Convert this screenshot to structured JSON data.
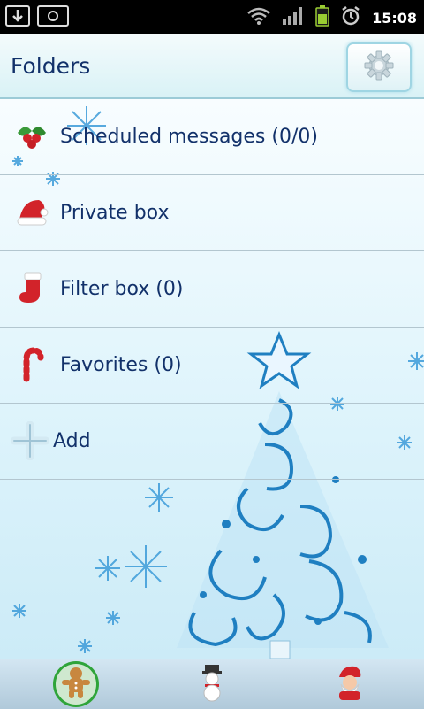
{
  "status_bar": {
    "time": "15:08",
    "icons": [
      "download-icon",
      "screenshot-icon",
      "wifi-icon",
      "signal-icon",
      "battery-icon",
      "alarm-icon"
    ]
  },
  "header": {
    "title": "Folders",
    "settings_icon": "gear-icon"
  },
  "folders": [
    {
      "label": "Scheduled messages (0/0)",
      "icon": "holly-icon"
    },
    {
      "label": "Private box",
      "icon": "santa-hat-icon"
    },
    {
      "label": "Filter box (0)",
      "icon": "stocking-icon"
    },
    {
      "label": "Favorites (0)",
      "icon": "candy-cane-icon"
    },
    {
      "label": "Add",
      "icon": "plus-icon"
    }
  ],
  "bottom_tabs": [
    {
      "icon": "gingerbread-icon",
      "active": true
    },
    {
      "icon": "snowman-icon",
      "active": false
    },
    {
      "icon": "santa-icon",
      "active": false
    }
  ],
  "colors": {
    "accent": "#12316a",
    "header_bg": "#e6f6f9",
    "background": "#e4f6fc",
    "tree_blue": "#2a8fd0",
    "active_tab_green": "#2fa43a"
  }
}
